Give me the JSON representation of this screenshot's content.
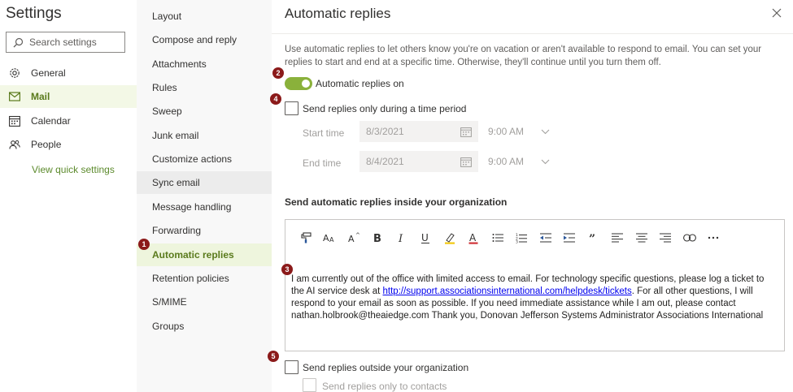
{
  "left": {
    "title": "Settings",
    "search_placeholder": "Search settings",
    "nav": [
      {
        "label": "General",
        "icon": "gear-icon"
      },
      {
        "label": "Mail",
        "icon": "mail-icon"
      },
      {
        "label": "Calendar",
        "icon": "calendar-icon"
      },
      {
        "label": "People",
        "icon": "people-icon"
      }
    ],
    "quick_settings": "View quick settings"
  },
  "middle": {
    "items": [
      "Layout",
      "Compose and reply",
      "Attachments",
      "Rules",
      "Sweep",
      "Junk email",
      "Customize actions",
      "Sync email",
      "Message handling",
      "Forwarding",
      "Automatic replies",
      "Retention policies",
      "S/MIME",
      "Groups"
    ]
  },
  "pane": {
    "title": "Automatic replies",
    "description": "Use automatic replies to let others know you're on vacation or aren't available to respond to email. You can set your replies to start and end at a specific time. Otherwise, they'll continue until you turn them off.",
    "toggle_label": "Automatic replies on",
    "toggle_on": true,
    "time_period_label": "Send replies only during a time period",
    "start_label": "Start time",
    "start_date": "8/3/2021",
    "start_time": "9:00 AM",
    "end_label": "End time",
    "end_date": "8/4/2021",
    "end_time": "9:00 AM",
    "inside_heading": "Send automatic replies inside your organization",
    "message_part1": "I am currently out of the office with limited access to email. For technology specific questions, please log a ticket to the AI service desk at ",
    "message_link": "http://support.associationsinternational.com/helpdesk/tickets",
    "message_part2": ". For all other questions, I will respond to your email as soon as possible. If you need immediate assistance while I am out, please contact nathan.holbrook@theaiedge.com Thank you, Donovan Jefferson Systems Administrator Associations International",
    "outside_label": "Send replies outside your organization",
    "contacts_label": "Send replies only to contacts"
  },
  "badges": [
    "1",
    "2",
    "3",
    "4",
    "5"
  ],
  "colors": {
    "accent": "#8ab13b",
    "active_text": "#5a7a1c",
    "badge": "#8b1a1a",
    "link": "#0000ee"
  }
}
